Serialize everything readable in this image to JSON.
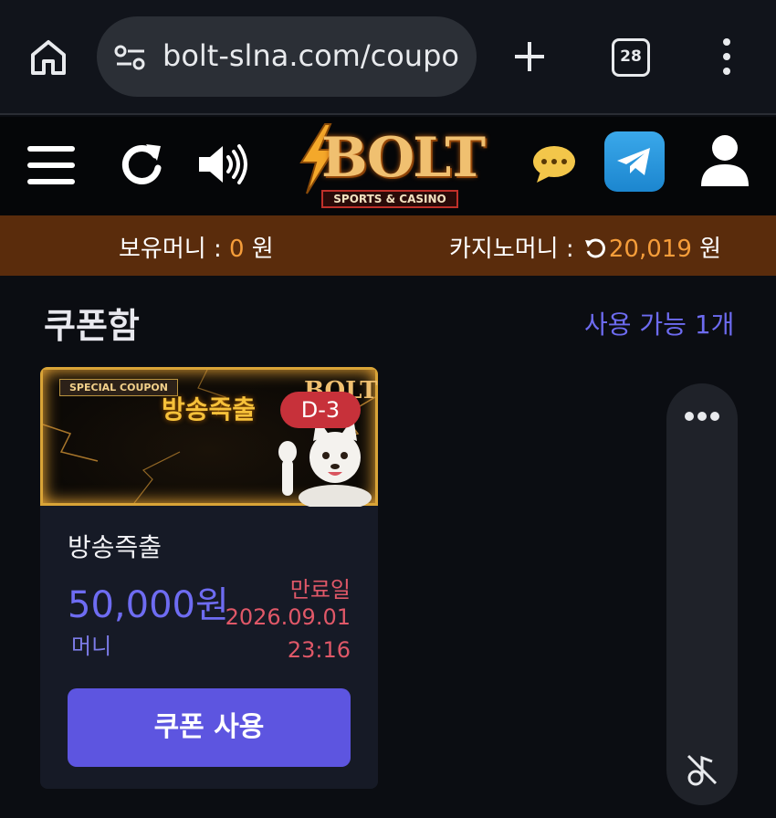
{
  "browser": {
    "url": "bolt-slna.com/coupo",
    "tab_count": "28",
    "icons": [
      "home-icon",
      "site-settings-icon",
      "new-tab-icon",
      "tab-switcher-icon",
      "more-options-icon"
    ]
  },
  "header": {
    "logo_text": "BOLT",
    "logo_sub": "SPORTS & CASINO",
    "icons": [
      "hamburger-menu-icon",
      "refresh-icon",
      "speaker-icon",
      "chat-icon",
      "telegram-icon",
      "user-icon"
    ]
  },
  "balance": {
    "money_label": "보유머니 : ",
    "money_value": "0",
    "money_unit": " 원",
    "casino_label": "카지노머니 : ",
    "casino_value": "20,019",
    "casino_unit": " 원"
  },
  "coupons": {
    "title": "쿠폰함",
    "available_text": "사용 가능 1개",
    "items": [
      {
        "banner_special": "SPECIAL COUPON",
        "banner_title": "방송즉출",
        "banner_logo": "BOLT",
        "dday": "D-3",
        "name": "방송즉출",
        "amount": "50,000원",
        "type": "머니",
        "expiry_label": "만료일",
        "expiry_date": "2026.09.01",
        "expiry_time": "23:16",
        "use_button": "쿠폰 사용"
      }
    ]
  },
  "colors": {
    "accent": "#5d55e0",
    "balance_bar": "#5a2c0c",
    "orange": "#f59d3a",
    "expiry": "#e05868"
  }
}
